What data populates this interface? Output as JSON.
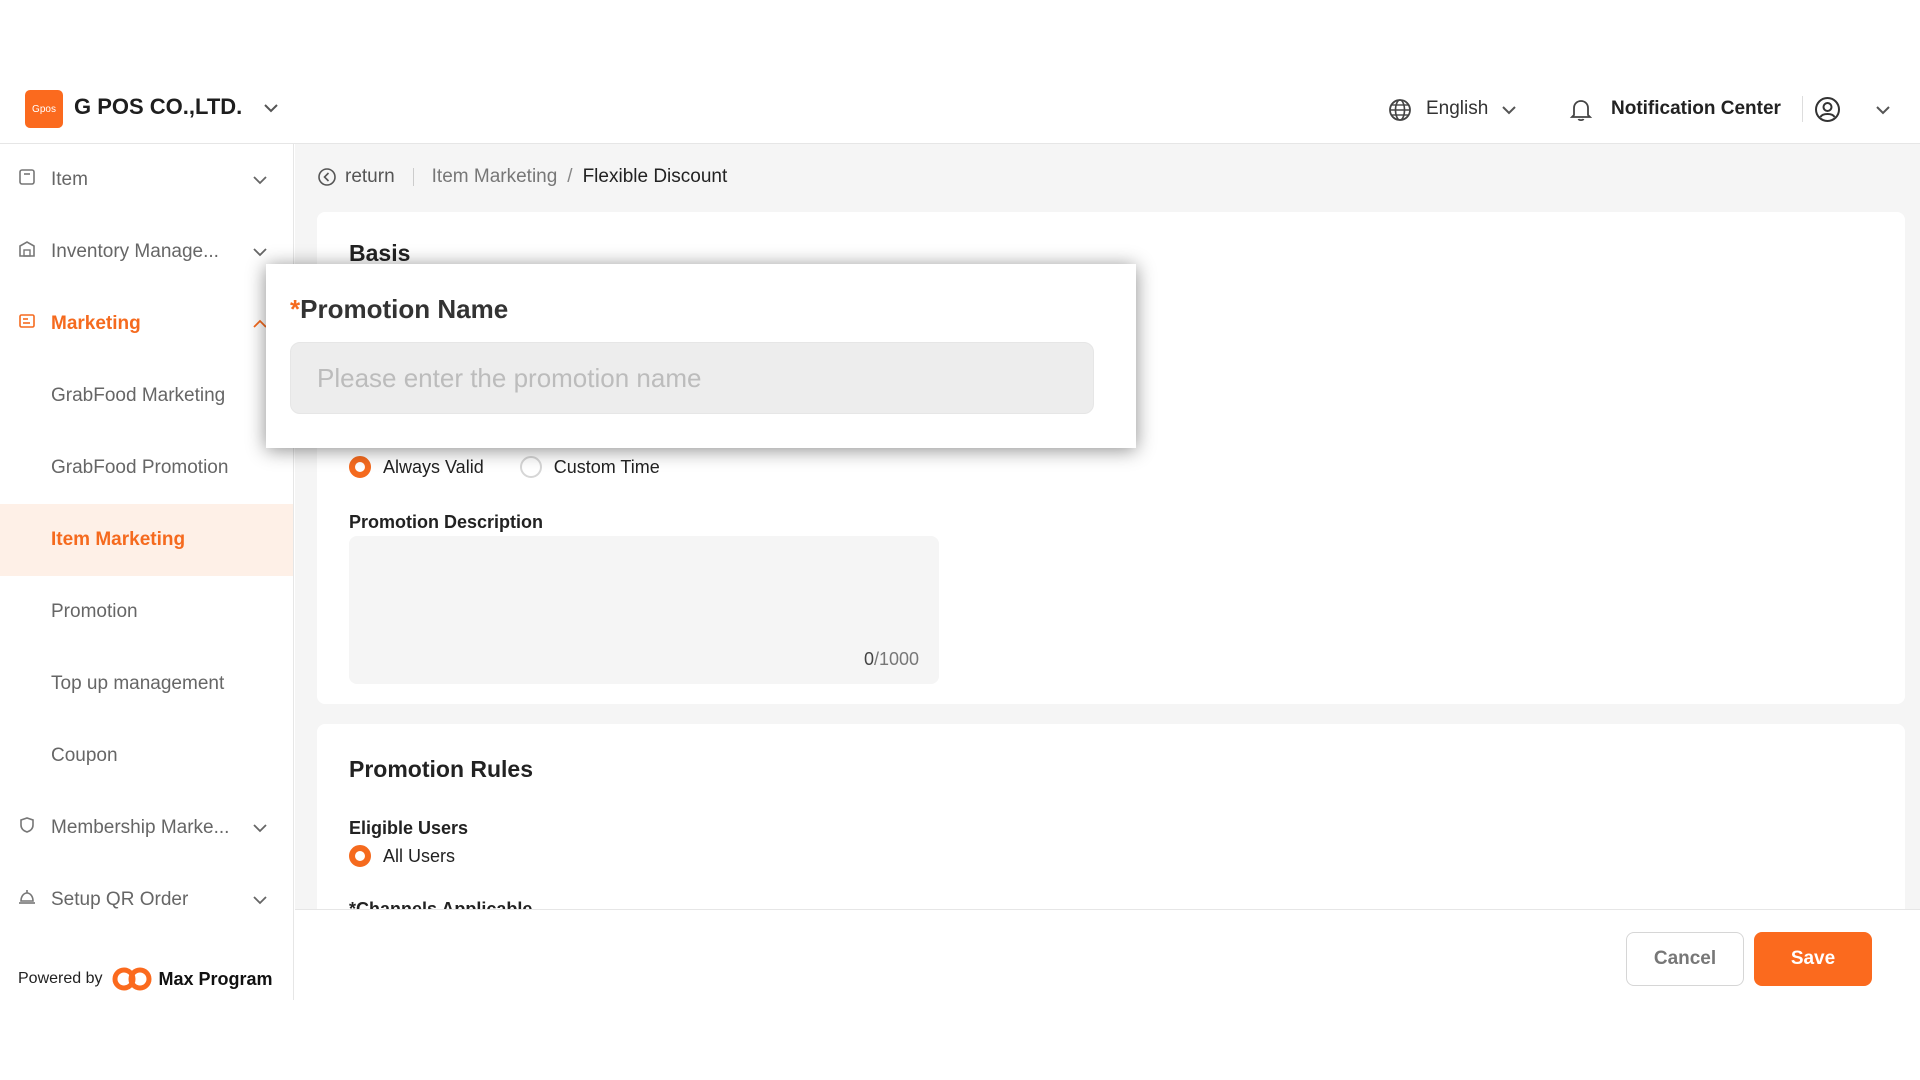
{
  "header": {
    "logo_text": "Gpos",
    "company": "G POS CO.,LTD.",
    "language": "English",
    "notification": "Notification Center"
  },
  "sidebar": {
    "items": [
      {
        "label": "Item",
        "icon": "item-icon"
      },
      {
        "label": "Inventory Manage...",
        "icon": "warehouse-icon"
      },
      {
        "label": "Marketing",
        "icon": "marketing-icon"
      },
      {
        "label": "GrabFood Marketing"
      },
      {
        "label": "GrabFood Promotion"
      },
      {
        "label": "Item Marketing"
      },
      {
        "label": "Promotion"
      },
      {
        "label": "Top up management"
      },
      {
        "label": "Coupon"
      },
      {
        "label": "Membership Marke...",
        "icon": "membership-icon"
      },
      {
        "label": "Setup QR Order",
        "icon": "service-bell-icon"
      }
    ],
    "powered_by": "Powered by",
    "brand": "Max Program"
  },
  "breadcrumb": {
    "return": "return",
    "parent": "Item Marketing",
    "separator": "/",
    "current": "Flexible Discount"
  },
  "basis": {
    "title": "Basis",
    "validity_options": [
      "Always Valid",
      "Custom Time"
    ],
    "validity_selected": "Always Valid",
    "description_label": "Promotion Description",
    "description_counter_current": "0",
    "description_counter_max": "/1000"
  },
  "rules": {
    "title": "Promotion Rules",
    "eligible_label": "Eligible Users",
    "eligible_option": "All Users",
    "channels_label": "*Channels Applicable"
  },
  "footer": {
    "cancel": "Cancel",
    "save": "Save"
  },
  "popup": {
    "required_mark": "*",
    "label": "Promotion Name",
    "placeholder": "Please enter the promotion name"
  },
  "colors": {
    "accent": "#fb6a1e",
    "selected_bg": "#fef0e7"
  }
}
